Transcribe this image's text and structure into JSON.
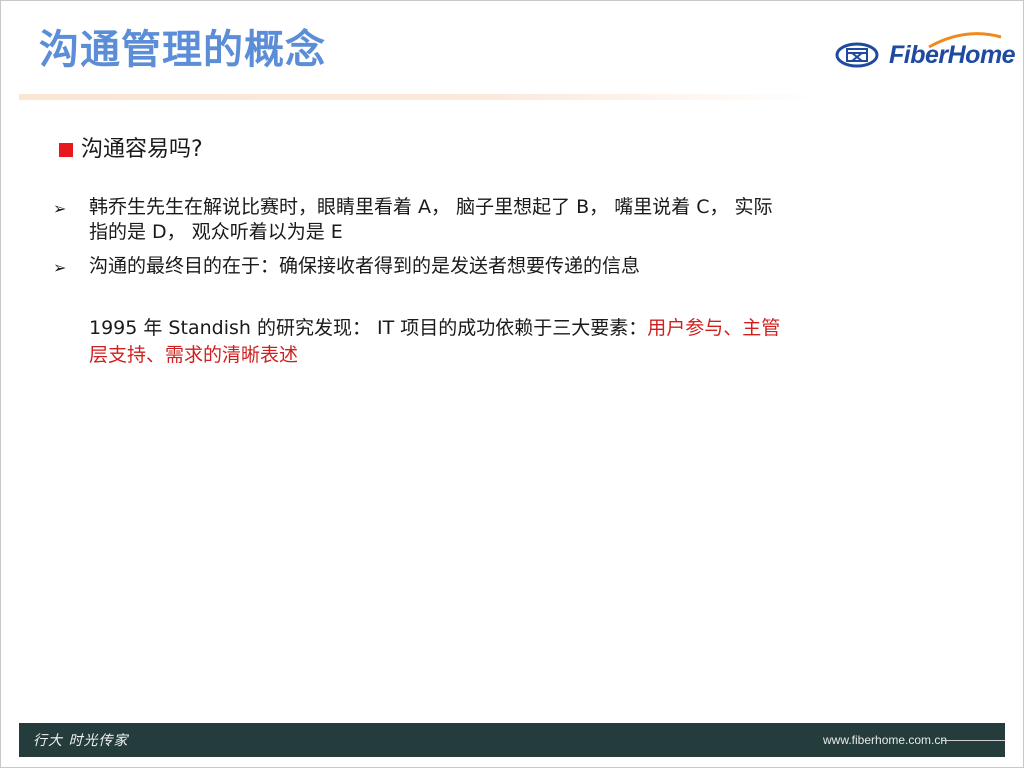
{
  "slide": {
    "title": "沟通管理的概念",
    "logo_text": "FiberHome",
    "heading": "沟通容易吗?",
    "bullets": [
      {
        "icon": "arrow-bullet-icon",
        "line1": "韩乔生先生在解说比赛时，眼睛里看着 A， 脑子里想起了 B， 嘴里说着 C， 实际",
        "line2": "指的是 D， 观众听着以为是 E"
      },
      {
        "icon": "arrow-bullet-icon",
        "line1": "沟通的最终目的在于：确保接收者得到的是发送者想要传递的信息"
      }
    ],
    "paragraph": {
      "line1_plain": "1995 年 Standish 的研究发现： IT 项目的成功依赖于三大要素：",
      "line1_red": "用户参与、主管",
      "line2_red": "层支持、需求的清晰表述"
    },
    "footer": {
      "signature": "行大 时光传家",
      "url": "www.fiberhome.com.cn"
    },
    "colors": {
      "title": "#5b8ed6",
      "bullet_square": "#e8191c",
      "highlight": "#d01f1f",
      "footer_bg": "#243c3c",
      "logo": "#1f4aa0",
      "logo_swoosh": "#f08a1c"
    }
  }
}
